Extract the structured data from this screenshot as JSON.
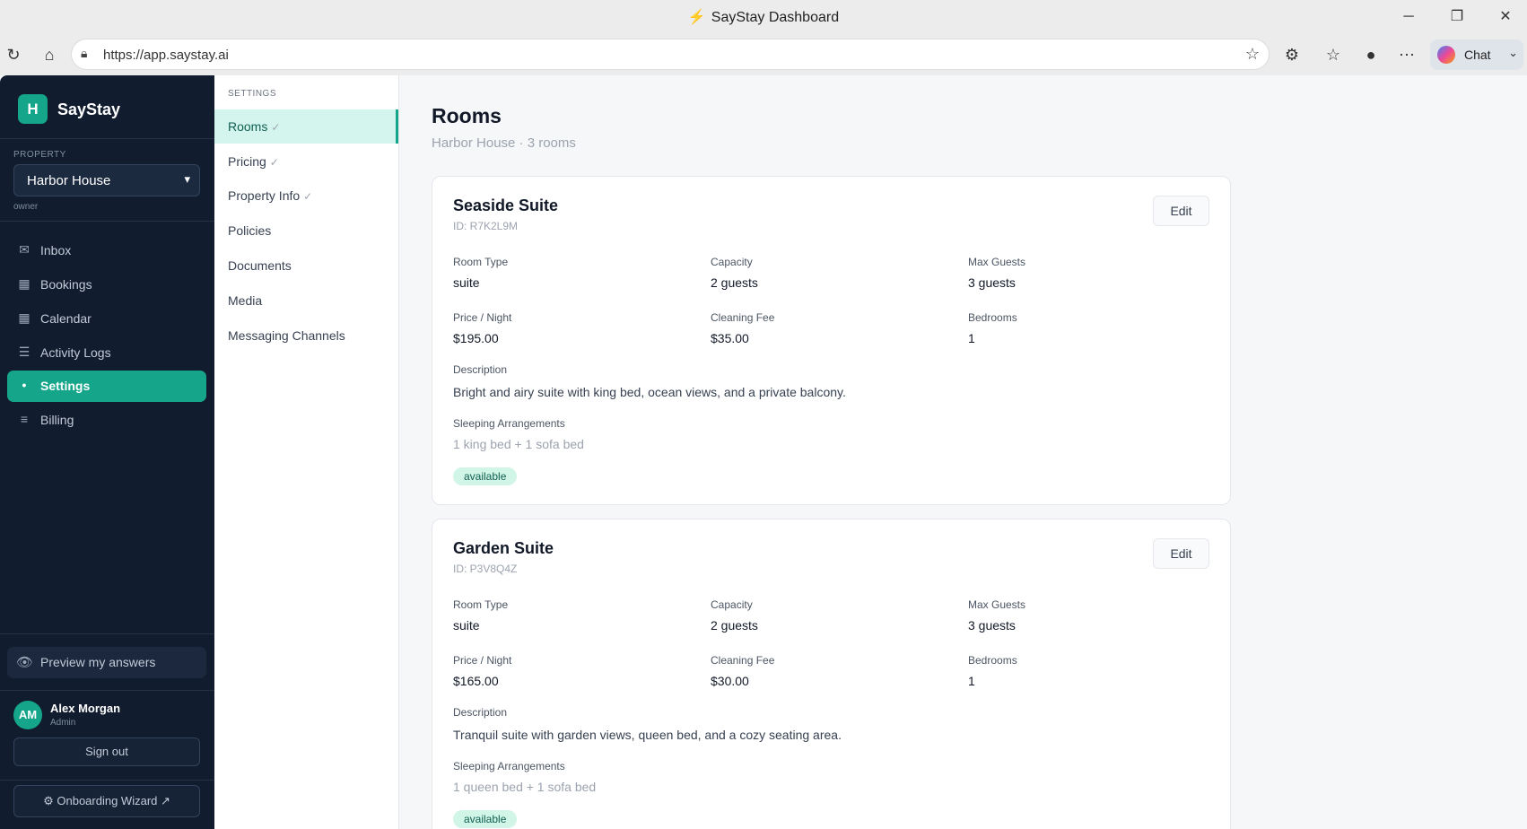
{
  "browser": {
    "window_title": "SayStay Dashboard",
    "url": "https://app.saystay.ai",
    "chat_label": "Chat"
  },
  "sidebar": {
    "logo_letter": "H",
    "brand": "SayStay",
    "property_label": "PROPERTY",
    "property_value": "Harbor House",
    "property_role": "owner",
    "items": [
      {
        "label": "Inbox",
        "icon": "mail-icon"
      },
      {
        "label": "Bookings",
        "icon": "calendar-icon"
      },
      {
        "label": "Calendar",
        "icon": "calendar-icon"
      },
      {
        "label": "Activity Logs",
        "icon": "list-icon"
      },
      {
        "label": "Settings",
        "icon": "dot-icon",
        "active": true
      },
      {
        "label": "Billing",
        "icon": "menu-icon"
      }
    ],
    "preview_label": "Preview my answers",
    "user": {
      "initials": "AM",
      "name": "Alex Morgan",
      "role": "Admin"
    },
    "sign_out": "Sign out",
    "onboarding": "⚙ Onboarding Wizard ↗"
  },
  "settings_nav": {
    "heading": "SETTINGS",
    "items": [
      {
        "label": "Rooms",
        "check": "✓",
        "active": true
      },
      {
        "label": "Pricing",
        "check": "✓"
      },
      {
        "label": "Property Info",
        "check": "✓"
      },
      {
        "label": "Policies",
        "check": ""
      },
      {
        "label": "Documents",
        "check": ""
      },
      {
        "label": "Media",
        "check": ""
      },
      {
        "label": "Messaging Channels",
        "check": ""
      }
    ]
  },
  "main": {
    "title": "Rooms",
    "subtitle": "Harbor House · 3 rooms",
    "labels": {
      "room_type": "Room Type",
      "capacity": "Capacity",
      "max_guests": "Max Guests",
      "price": "Price / Night",
      "cleaning": "Cleaning Fee",
      "bedrooms": "Bedrooms",
      "description": "Description",
      "sleeping": "Sleeping Arrangements",
      "edit": "Edit"
    },
    "rooms": [
      {
        "name": "Seaside Suite",
        "id": "ID: R7K2L9M",
        "room_type": "suite",
        "capacity": "2 guests",
        "max_guests": "3 guests",
        "price": "$195.00",
        "cleaning": "$35.00",
        "bedrooms": "1",
        "description": "Bright and airy suite with king bed, ocean views, and a private balcony.",
        "sleeping": "1 king bed + 1 sofa bed",
        "status": "available"
      },
      {
        "name": "Garden Suite",
        "id": "ID: P3V8Q4Z",
        "room_type": "suite",
        "capacity": "2 guests",
        "max_guests": "3 guests",
        "price": "$165.00",
        "cleaning": "$30.00",
        "bedrooms": "1",
        "description": "Tranquil suite with garden views, queen bed, and a cozy seating area.",
        "sleeping": "1 queen bed + 1 sofa bed",
        "status": "available"
      }
    ]
  }
}
